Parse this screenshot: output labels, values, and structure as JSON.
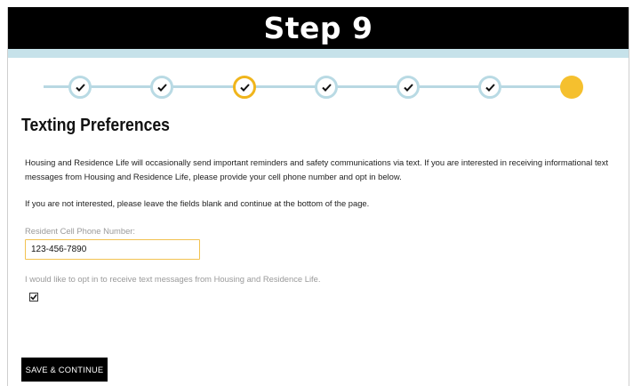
{
  "banner": {
    "title": "Step 9"
  },
  "progress": {
    "steps": [
      {
        "state": "complete"
      },
      {
        "state": "complete"
      },
      {
        "state": "complete-current"
      },
      {
        "state": "complete"
      },
      {
        "state": "complete"
      },
      {
        "state": "complete"
      },
      {
        "state": "current"
      }
    ],
    "colors": {
      "line": "#b8d8e2",
      "ring": "#b9dae4",
      "highlight": "#f0b51c",
      "current": "#f5c02e"
    }
  },
  "section": {
    "heading": "Texting Preferences",
    "intro_line1": "Housing and Residence Life will occasionally send important reminders and safety communications via text. If you are interested in receiving informational text",
    "intro_line2": "messages from Housing and Residence Life, please provide your cell phone number and opt in below.",
    "skip_note": "If you are not interested, please leave the fields blank and continue at the bottom of the page."
  },
  "form": {
    "phone_label": "Resident Cell Phone Number:",
    "phone_value": "123-456-7890",
    "optin_label": "I would like to opt in to receive text messages from Housing and Residence Life.",
    "optin_checked": true
  },
  "actions": {
    "save_label": "SAVE & CONTINUE"
  },
  "colors": {
    "banner_bg": "#000000",
    "accent_strip": "#c6e2ea",
    "input_focus_border": "#f2c250"
  }
}
